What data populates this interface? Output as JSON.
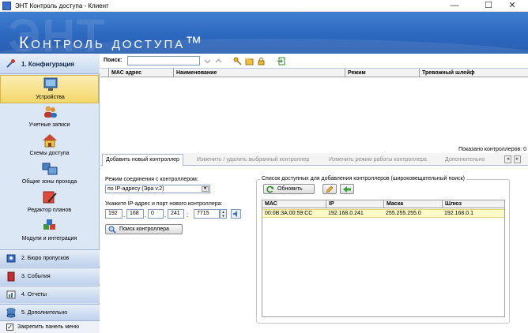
{
  "window": {
    "title": "ЭНТ Контроль доступа - Клиент",
    "minimize": "—",
    "maximize": "☐",
    "close": "✕"
  },
  "banner": {
    "brand": "Контроль доступа™",
    "bg_text": "ЭНТ"
  },
  "sidebar": {
    "header": "1. Конфигурация",
    "items": [
      {
        "label": "Устройства",
        "icon": "monitor-icon",
        "selected": true
      },
      {
        "label": "Учетные записи",
        "icon": "users-icon",
        "selected": false
      },
      {
        "label": "Схемы доступа",
        "icon": "house-icon",
        "selected": false
      },
      {
        "label": "Общие зоны прохода",
        "icon": "zones-icon",
        "selected": false
      },
      {
        "label": "Редактор планов",
        "icon": "plan-editor-icon",
        "selected": false
      },
      {
        "label": "Модули и интеграция",
        "icon": "modules-icon",
        "selected": false
      }
    ],
    "sections": [
      {
        "label": "2. Бюро пропусков",
        "icon": "passes-icon"
      },
      {
        "label": "3. События",
        "icon": "events-icon"
      },
      {
        "label": "4. Отчеты",
        "icon": "reports-icon"
      },
      {
        "label": "5. Дополнительно",
        "icon": "database-icon"
      }
    ],
    "pin_label": "Закрепить панель меню",
    "pin_checked": true
  },
  "toolbar": {
    "search_label": "Поиск:",
    "search_value": ""
  },
  "controllers_table": {
    "columns": [
      "МАС адрес",
      "Наименование",
      "Режим",
      "Тревожный шлейф"
    ],
    "rows": [],
    "found_label": "Показано контроллеров: 0"
  },
  "tabs": [
    {
      "label": "Добавить новый контроллер",
      "active": true
    },
    {
      "label": "Изменить / удалить выбранный контроллер",
      "active": false
    },
    {
      "label": "Изменить режим работы контроллера",
      "active": false
    },
    {
      "label": "Дополнительно",
      "active": false
    }
  ],
  "add_form": {
    "mode_label": "Режим соединения с контроллером:",
    "mode_value": "по IP-адресу (Эра v.2)",
    "ip_label": "Укажите IP-адрес и порт нового контроллера:",
    "ip": [
      "192",
      "168",
      "0",
      "241"
    ],
    "port": "7715",
    "search_button": "Поиск контроллера"
  },
  "discovery": {
    "group_title": "Список доступных для добавления контроллеров (широковещательный поиск)",
    "refresh_button": "Обновить",
    "columns": [
      "МАС",
      "IP",
      "Маска",
      "Шлюз"
    ],
    "rows": [
      {
        "mac": "00:0B:3A:00:59:CC",
        "ip": "192.168.0.241",
        "mask": "255.255.255.0",
        "gateway": "192.168.0.1"
      }
    ]
  },
  "colors": {
    "banner": "#2d68bf",
    "sidebar": "#dce7f6",
    "selected": "#f4d66a",
    "row_highlight": "#fffbc8"
  }
}
